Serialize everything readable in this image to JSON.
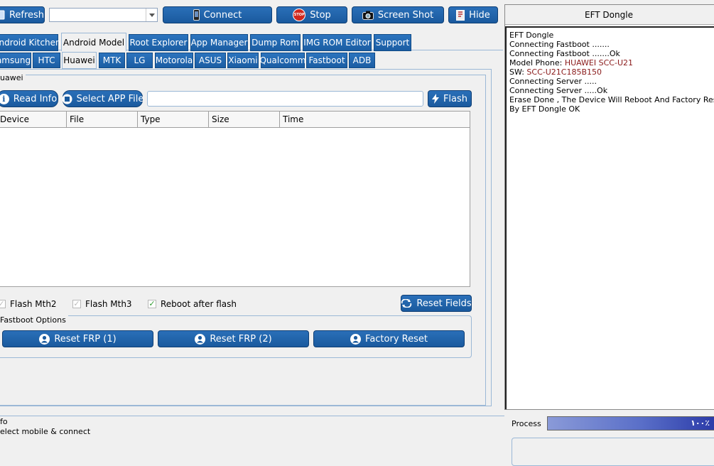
{
  "toolbar": {
    "refresh": "Refresh",
    "port_select": "",
    "connect": "Connect",
    "stop": "Stop",
    "stop_icon_text": "STOP",
    "screenshot": "Screen Shot",
    "hide": "Hide"
  },
  "main_tabs": [
    "Android Kitchen",
    "Android Model",
    "Root Explorer",
    "App Manager",
    "Dump Rom",
    "IMG ROM Editor",
    "Support"
  ],
  "brand_tabs": [
    "amsung",
    "HTC",
    "Huawei",
    "MTK",
    "LG",
    "Motorola",
    "ASUS",
    "Xiaomi",
    "Qualcomm",
    "Fastboot",
    "ADB"
  ],
  "huawei": {
    "group_label": "uawei",
    "read_info": "Read Info",
    "select_app": "Select APP File",
    "file_path": "",
    "flash": "Flash",
    "columns": [
      "Device",
      "File",
      "Type",
      "Size",
      "Time"
    ],
    "opt_mth2": "Flash Mth2",
    "opt_mth3": "Flash Mth3",
    "opt_reboot": "Reboot after flash",
    "reset_fields": "Reset Fields",
    "fastboot_group": "Fastboot Options",
    "reset_frp1": "Reset FRP (1)",
    "reset_frp2": "Reset FRP (2)",
    "factory_reset": "Factory Reset"
  },
  "info": {
    "label": "fo",
    "text": "elect mobile & connect"
  },
  "log": {
    "title": "EFT Dongle",
    "lines": [
      {
        "a": "EFT Dongle",
        "b": ""
      },
      {
        "a": "Connecting Fastboot .......",
        "b": ""
      },
      {
        "a": "Connecting Fastboot .......Ok",
        "b": ""
      },
      {
        "a": "Model Phone: ",
        "b": "HUAWEI SCC-U21"
      },
      {
        "a": "SW: ",
        "b": "SCC-U21C185B150"
      },
      {
        "a": "Connecting Server .....",
        "b": ""
      },
      {
        "a": "Connecting Server .....Ok",
        "b": ""
      },
      {
        "a": "Erase Done , The Device Will Reboot And Factory Reset",
        "b": ""
      },
      {
        "a": "By EFT Dongle OK",
        "b": ""
      }
    ]
  },
  "process": {
    "label": "Process",
    "percent_text": "١٠٠٪",
    "value": 1.0
  }
}
